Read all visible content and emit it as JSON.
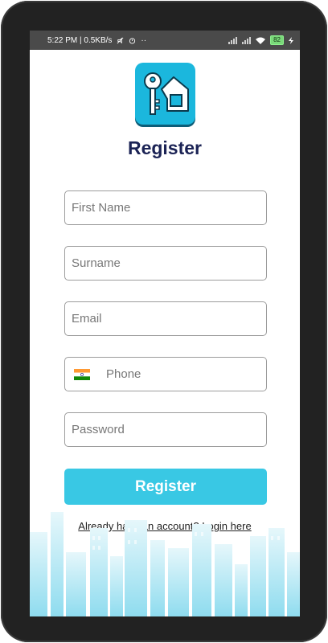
{
  "status_bar": {
    "time_info": "5:22 PM | 0.5KB/s",
    "battery": "82"
  },
  "page": {
    "title": "Register"
  },
  "form": {
    "first_name_placeholder": "First Name",
    "surname_placeholder": "Surname",
    "email_placeholder": "Email",
    "phone_placeholder": "Phone",
    "password_placeholder": "Password",
    "submit_label": "Register",
    "login_link": "Already have an account? Login here"
  },
  "colors": {
    "accent": "#39c8e4",
    "title": "#1b2355",
    "logo_bg": "#1bb7dd"
  },
  "icons": {
    "app_logo": "key-house-logo-icon",
    "country_flag": "india-flag-icon"
  }
}
